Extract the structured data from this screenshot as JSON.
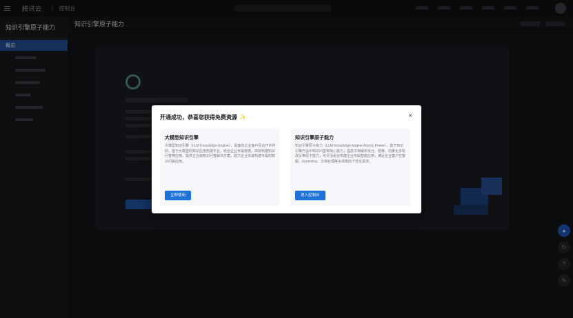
{
  "topbar": {
    "logo": "腾讯云",
    "home": "控制台"
  },
  "sidebar": {
    "title": "知识引擎原子能力",
    "items": [
      {
        "label": "概览",
        "active": true
      },
      {
        "label": "",
        "active": false
      },
      {
        "label": "",
        "active": false
      },
      {
        "label": "",
        "active": false
      },
      {
        "label": "",
        "active": false
      },
      {
        "label": "",
        "active": false
      },
      {
        "label": "",
        "active": false
      }
    ]
  },
  "main": {
    "heading": "知识引擎原子能力"
  },
  "modal": {
    "title": "开通成功，恭喜您获得免费资源",
    "title_emoji": "✨",
    "close_icon": "×",
    "left_panel": {
      "title": "大模型知识引擎",
      "description": "大模型知识引擎（LLM Knowledge Engine），是面向企业客户及合作伙伴的，基于大模型的知识应用构建平台，结合企业专属数据，高效构建知识问答等应用。提供企业级知识问答解决方案，助力企业快速构建专属的知识问答应用。",
      "button": "立即使用"
    },
    "right_panel": {
      "title": "知识引擎原子能力",
      "description": "知识引擎原子能力（LLM Knowledge Engine Atomic Power），基于知识引擎产品中知识问答等核心能力，提供文档解析拆分、检索、向量化多轮改写等原子能力，可灵活组合构建企业专属智能应用，满足企业客户在客服、marketing、文档处理等多场景的个性化需求。",
      "button": "进入控制台"
    }
  },
  "float_buttons": [
    "chat-icon",
    "share-icon",
    "help-icon",
    "edit-icon"
  ]
}
